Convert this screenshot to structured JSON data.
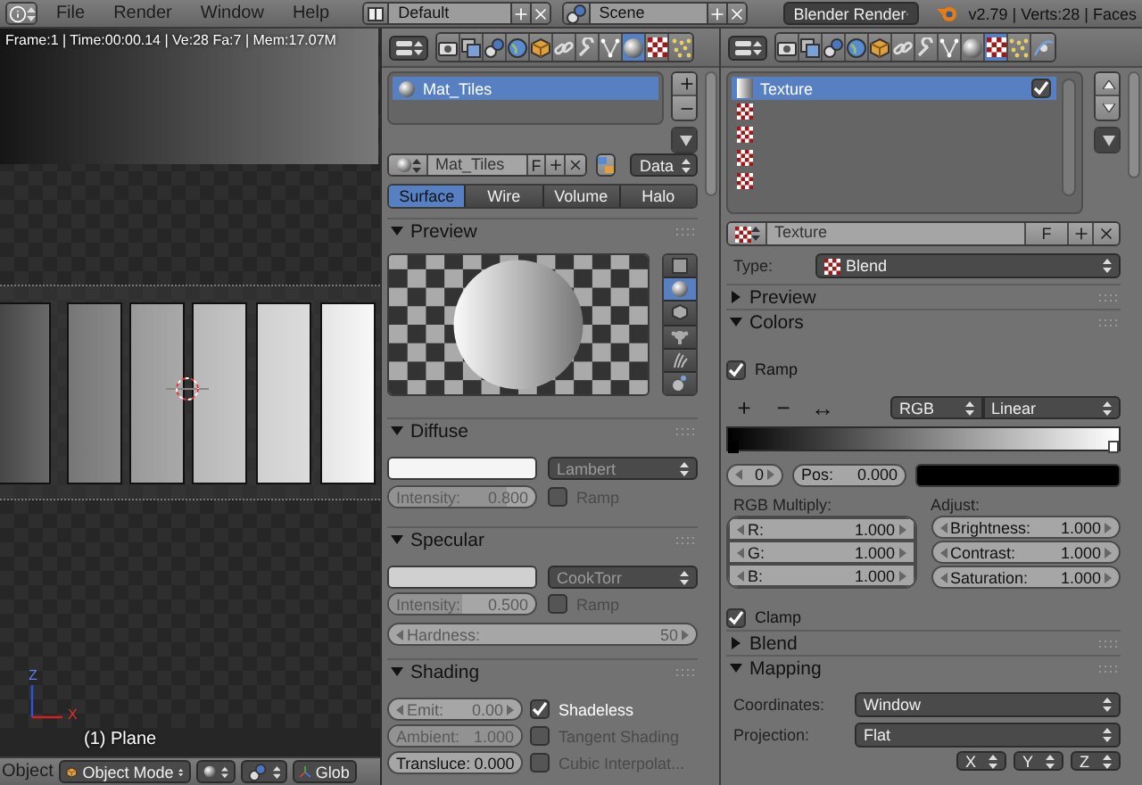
{
  "top_bar": {
    "menus": [
      "File",
      "Render",
      "Window",
      "Help"
    ],
    "layout": "Default",
    "scene": "Scene",
    "engine": "Blender Render",
    "stats": "v2.79 | Verts:28 | Faces"
  },
  "viewport": {
    "info": "Frame:1 | Time:00:00.14 | Ve:28 Fa:7 | Mem:17.07M",
    "axes": [
      "Z",
      "X"
    ],
    "object_label": "(1) Plane"
  },
  "viewport_header": {
    "editor": "Object",
    "mode": "Object Mode",
    "orientation": "Glob"
  },
  "material_panel": {
    "context_tabs": [
      {
        "kind": "render",
        "selected": false
      },
      {
        "kind": "layers",
        "selected": false
      },
      {
        "kind": "scene",
        "selected": false
      },
      {
        "kind": "world",
        "selected": false
      },
      {
        "kind": "object",
        "selected": false
      },
      {
        "kind": "constraints",
        "selected": false
      },
      {
        "kind": "modifiers",
        "selected": false
      },
      {
        "kind": "data",
        "selected": false
      },
      {
        "kind": "material",
        "selected": true
      },
      {
        "kind": "texture",
        "selected": false
      },
      {
        "kind": "particles",
        "selected": false
      }
    ],
    "slots": [
      {
        "name": "Mat_Tiles",
        "selected": true
      }
    ],
    "datablock": {
      "name": "Mat_Tiles",
      "fake_user": "F",
      "link": "Data"
    },
    "tabs": [
      {
        "label": "Surface",
        "selected": true
      },
      {
        "label": "Wire",
        "selected": false
      },
      {
        "label": "Volume",
        "selected": false
      },
      {
        "label": "Halo",
        "selected": false
      }
    ],
    "preview": {
      "title": "Preview",
      "expanded": true,
      "shapes": [
        {
          "kind": "flat",
          "selected": false
        },
        {
          "kind": "sphere",
          "selected": true
        },
        {
          "kind": "cube",
          "selected": false
        },
        {
          "kind": "monkey",
          "selected": false
        },
        {
          "kind": "hair",
          "selected": false
        },
        {
          "kind": "sky",
          "selected": false
        }
      ]
    },
    "diffuse": {
      "title": "Diffuse",
      "expanded": true,
      "color": "#f5f5f5",
      "shader": {
        "value": "Lambert",
        "disabled": true
      },
      "intensity": {
        "kind": "slider",
        "label": "Intensity:",
        "value": "0.800",
        "level": 0.8,
        "disabled": true
      },
      "ramp": {
        "label": "Ramp",
        "checked": false,
        "disabled": true
      }
    },
    "specular": {
      "title": "Specular",
      "expanded": true,
      "color": "#d0d0d0",
      "shader": {
        "value": "CookTorr",
        "disabled": true
      },
      "intensity": {
        "kind": "slider",
        "label": "Intensity:",
        "value": "0.500",
        "level": 0.5,
        "disabled": true
      },
      "ramp": {
        "label": "Ramp",
        "checked": false,
        "disabled": true
      },
      "hardness": {
        "kind": "number",
        "label": "Hardness:",
        "value": "50",
        "disabled": true
      }
    },
    "shading": {
      "title": "Shading",
      "expanded": true,
      "fields": [
        {
          "kind": "number",
          "label": "Emit:",
          "value": "0.00",
          "disabled": true
        },
        {
          "kind": "slider",
          "label": "Ambient:",
          "value": "1.000",
          "level": 1,
          "disabled": true
        },
        {
          "kind": "slider",
          "label": "Transluce:",
          "value": "0.000",
          "level": 0,
          "disabled": false
        }
      ],
      "options": [
        {
          "label": "Shadeless",
          "checked": true,
          "disabled": false
        },
        {
          "label": "Tangent Shading",
          "checked": false,
          "disabled": true
        },
        {
          "label": "Cubic Interpolat...",
          "checked": false,
          "disabled": true
        }
      ]
    }
  },
  "texture_panel": {
    "context_tabs": [
      {
        "kind": "render",
        "selected": false
      },
      {
        "kind": "layers",
        "selected": false
      },
      {
        "kind": "scene",
        "selected": false
      },
      {
        "kind": "world",
        "selected": false
      },
      {
        "kind": "object",
        "selected": false
      },
      {
        "kind": "constraints",
        "selected": false
      },
      {
        "kind": "modifiers",
        "selected": false
      },
      {
        "kind": "data",
        "selected": false
      },
      {
        "kind": "material",
        "selected": false
      },
      {
        "kind": "texture",
        "selected": true
      },
      {
        "kind": "particles",
        "selected": false
      },
      {
        "kind": "physics",
        "selected": false
      }
    ],
    "slots": [
      {
        "kind": "texture",
        "name": "Texture",
        "selected": true,
        "checked": true
      },
      {
        "kind": "empty",
        "selected": false
      },
      {
        "kind": "empty",
        "selected": false
      },
      {
        "kind": "empty",
        "selected": false
      },
      {
        "kind": "empty",
        "selected": false
      }
    ],
    "datablock": {
      "name": "Texture",
      "fake_user": "F"
    },
    "type": {
      "label": "Type:",
      "value": "Blend"
    },
    "sections": [
      {
        "title": "Preview",
        "expanded": false
      },
      {
        "kind": "colors",
        "title": "Colors",
        "expanded": true,
        "ramp": {
          "label": "Ramp",
          "checked": true
        },
        "tools": [
          "+",
          "−",
          "↔"
        ],
        "color_mode": "RGB",
        "interpolation": "Linear",
        "stops": [
          {
            "color": "#000000",
            "selected": true
          },
          {
            "color": "#ffffff",
            "selected": false
          }
        ],
        "active_stop": {
          "kind": "number",
          "value": "0"
        },
        "position": {
          "kind": "slider",
          "label": "Pos:",
          "value": "0.000"
        },
        "swatch": {
          "color": "#000000"
        },
        "rgb_multiply": {
          "title": "RGB Multiply:",
          "fields": [
            {
              "kind": "number",
              "label": "R:",
              "value": "1.000"
            },
            {
              "kind": "number",
              "label": "G:",
              "value": "1.000"
            },
            {
              "kind": "number",
              "label": "B:",
              "value": "1.000"
            }
          ]
        },
        "adjust": {
          "title": "Adjust:",
          "fields": [
            {
              "kind": "number",
              "label": "Brightness:",
              "value": "1.000"
            },
            {
              "kind": "number",
              "label": "Contrast:",
              "value": "1.000"
            },
            {
              "kind": "number",
              "label": "Saturation:",
              "value": "1.000"
            }
          ]
        },
        "clamp": {
          "label": "Clamp",
          "checked": true
        }
      },
      {
        "title": "Blend",
        "expanded": false
      },
      {
        "kind": "mapping",
        "title": "Mapping",
        "expanded": true,
        "fields": [
          {
            "label": "Coordinates:",
            "value": "Window"
          },
          {
            "label": "Projection:",
            "value": "Flat"
          }
        ],
        "axes": [
          "X",
          "Y",
          "Z"
        ]
      }
    ]
  }
}
